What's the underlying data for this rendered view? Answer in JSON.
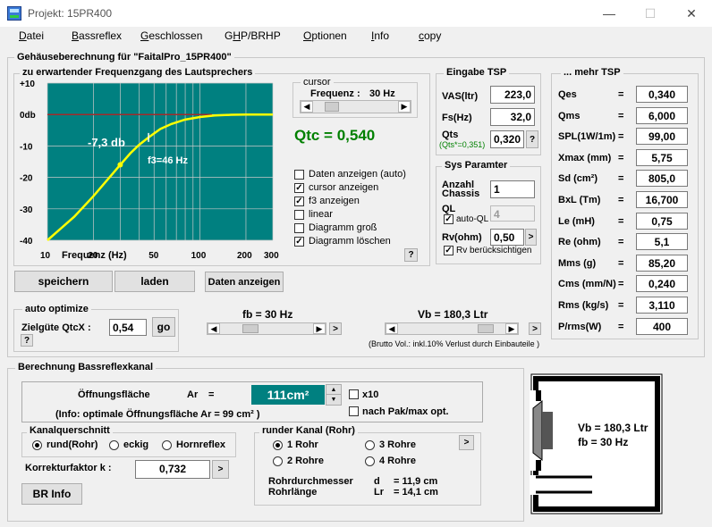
{
  "window": {
    "title": "Projekt: 15PR400",
    "minimize": "—",
    "maximize": "☐",
    "close": "✕"
  },
  "menu": [
    {
      "label": "Datei",
      "u": "D",
      "rest": "atei"
    },
    {
      "label": "Bassreflex",
      "u": "B",
      "rest": "assreflex"
    },
    {
      "label": "Geschlossen",
      "u": "G",
      "rest": "eschlossen"
    },
    {
      "label": "GHP/BRHP",
      "pre": "G",
      "u": "H",
      "rest": "P/BRHP"
    },
    {
      "label": "Optionen",
      "u": "O",
      "rest": "ptionen"
    },
    {
      "label": "Info",
      "u": "I",
      "rest": "nfo"
    },
    {
      "label": "copy",
      "u": "c",
      "rest": "opy"
    }
  ],
  "main": {
    "legend": "Gehäuseberechnung für \"FaitalPro_15PR400\""
  },
  "freq": {
    "legend": "zu erwartender Frequenzgang des Lautsprechers",
    "xlabel": "Frequenz (Hz)",
    "curve_label": "-7,3 db",
    "f3_label": "f3=46 Hz"
  },
  "chart_data": {
    "type": "line",
    "x": [
      10,
      15,
      20,
      25,
      30,
      35,
      40,
      46,
      55,
      65,
      80,
      100,
      125,
      160,
      200,
      300
    ],
    "y": [
      -40,
      -32.5,
      -26,
      -20.5,
      -16,
      -12.3,
      -9.6,
      -7.3,
      -4.6,
      -3.0,
      -1.6,
      -0.8,
      -0.3,
      -0.1,
      0,
      0
    ],
    "xscale": "log",
    "xticks": [
      "10",
      "20",
      "50",
      "100",
      "200",
      "300"
    ],
    "yticks": [
      "+10",
      "0db",
      "-10",
      "-20",
      "-30",
      "-40"
    ],
    "xlim": [
      10,
      300
    ],
    "ylim": [
      -40,
      10
    ],
    "cursor_x": 30,
    "cursor_y": -16,
    "f3": 46,
    "f3_y": -7.3,
    "reference_line": 0,
    "colors": {
      "plot_bg": "#008080",
      "curve": "#ffff00",
      "grid": "#c8c8c8",
      "reference": "#a52a2a"
    }
  },
  "cursor": {
    "legend": "cursor",
    "label": "Frequenz :",
    "value": "30 Hz",
    "position": 0.16
  },
  "qtc": "Qtc = 0,540",
  "options": [
    {
      "label": "Daten anzeigen (auto)",
      "checked": false
    },
    {
      "label": "cursor anzeigen",
      "checked": true
    },
    {
      "label": "f3 anzeigen",
      "checked": true
    },
    {
      "label": "linear",
      "checked": false
    },
    {
      "label": "Diagramm groß",
      "checked": false
    },
    {
      "label": "Diagramm  löschen",
      "checked": true
    }
  ],
  "help": "?",
  "buttons": {
    "speichern": "speichern",
    "laden": "laden",
    "daten": "Daten anzeigen",
    "go": "go",
    "br_info": "BR Info"
  },
  "eingabe": {
    "legend": "Eingabe TSP",
    "vas_label": "VAS(ltr)",
    "vas": "223,0",
    "fs_label": "Fs(Hz)",
    "fs": "32,0",
    "qts_label": "Qts",
    "qts_note": "(Qts*=0,351)",
    "qts": "0,320"
  },
  "sys": {
    "legend": "Sys Paramter",
    "anzahl_label1": "Anzahl",
    "anzahl_label2": "Chassis",
    "anzahl": "1",
    "ql_label": "QL",
    "ql": "4",
    "auto_ql": "auto-QL",
    "rv_label": "Rv(ohm)",
    "rv": "0,50",
    "rv_check": "Rv berücksichtigen"
  },
  "more": {
    "legend": "... mehr TSP",
    "rows": [
      {
        "label": "Qes",
        "val": "0,340"
      },
      {
        "label": "Qms",
        "val": "6,000"
      },
      {
        "label": "SPL(1W/1m)",
        "val": "99,00"
      },
      {
        "label": "Xmax (mm)",
        "val": "5,75"
      },
      {
        "label": "Sd (cm²)",
        "val": "805,0"
      },
      {
        "label": "BxL  (Tm)",
        "val": "16,700"
      },
      {
        "label": "Le (mH)",
        "val": "0,75"
      },
      {
        "label": "Re (ohm)",
        "val": "5,1"
      },
      {
        "label": "Mms  (g)",
        "val": "85,20"
      },
      {
        "label": "Cms (mm/N)",
        "val": "0,240"
      },
      {
        "label": "Rms  (kg/s)",
        "val": "3,110"
      },
      {
        "label": "P/rms(W)",
        "val": "400"
      }
    ],
    "eq": "="
  },
  "auto": {
    "legend": "auto optimize",
    "label": "Zielgüte QtcX :",
    "value": "0,54"
  },
  "fb": {
    "label": "fb =  30 Hz",
    "position": 0.28
  },
  "vb": {
    "label": "Vb = 180,3 Ltr",
    "position": 0.86,
    "note": "(Brutto Vol.: inkl.10% Verlust durch Einbauteile )"
  },
  "reflex": {
    "legend": "Berechnung  Bassreflexkanal",
    "area_label": "Öffnungsfläche",
    "ar_label": "Ar",
    "eq": "=",
    "area_value": "111cm²",
    "x10": "x10",
    "note": "(Info: optimale Öffnungsfläche    Ar = 99 cm² )",
    "pak": "nach Pak/max opt."
  },
  "kanal": {
    "legend": "Kanalquerschnitt",
    "options": [
      {
        "label": "rund(Rohr)",
        "on": true
      },
      {
        "label": "eckig",
        "on": false
      },
      {
        "label": "Hornreflex",
        "on": false
      }
    ]
  },
  "korrektur": {
    "label": "Korrekturfaktor k  :",
    "value": "0,732"
  },
  "rund": {
    "legend": "runder Kanal (Rohr)",
    "options": [
      {
        "label": "1 Rohr",
        "on": true
      },
      {
        "label": "3 Rohre",
        "on": false
      },
      {
        "label": "2 Rohre",
        "on": false
      },
      {
        "label": "4 Rohre",
        "on": false
      }
    ],
    "d_label": "Rohrdurchmesser",
    "d_sym": "d",
    "d_val": "=     11,9 cm",
    "l_label": "Rohrlänge",
    "l_sym": "Lr",
    "l_val": "=     14,1 cm"
  },
  "box": {
    "vb": "Vb = 180,3 Ltr",
    "fb": "fb =  30 Hz"
  },
  "arrow": ">"
}
